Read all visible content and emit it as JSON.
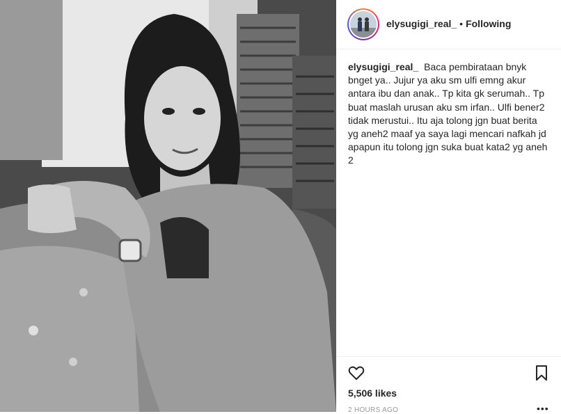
{
  "post": {
    "username": "elysugigi_real_",
    "separator": "•",
    "follow_status": "Following",
    "caption_user": "elysugigi_real_",
    "caption": "Baca pembirataan bnyk bnget ya.. Jujur ya aku sm ulfi emng akur antara ibu dan anak.. Tp kita gk serumah.. Tp buat maslah urusan aku sm irfan.. Ulfi bener2 tidak merustui.. Itu aja tolong jgn buat berita yg aneh2 maaf ya saya lagi mencari nafkah jd apapun itu tolong jgn suka buat kata2 yg aneh 2",
    "likes": "5,506 likes",
    "time": "2 HOURS AGO",
    "more_label": "•••"
  },
  "icons": {
    "like": "heart-outline-icon",
    "save": "bookmark-outline-icon",
    "more": "more-options-icon"
  },
  "colors": {
    "text": "#262626",
    "muted": "#999999",
    "border": "#efefef"
  }
}
